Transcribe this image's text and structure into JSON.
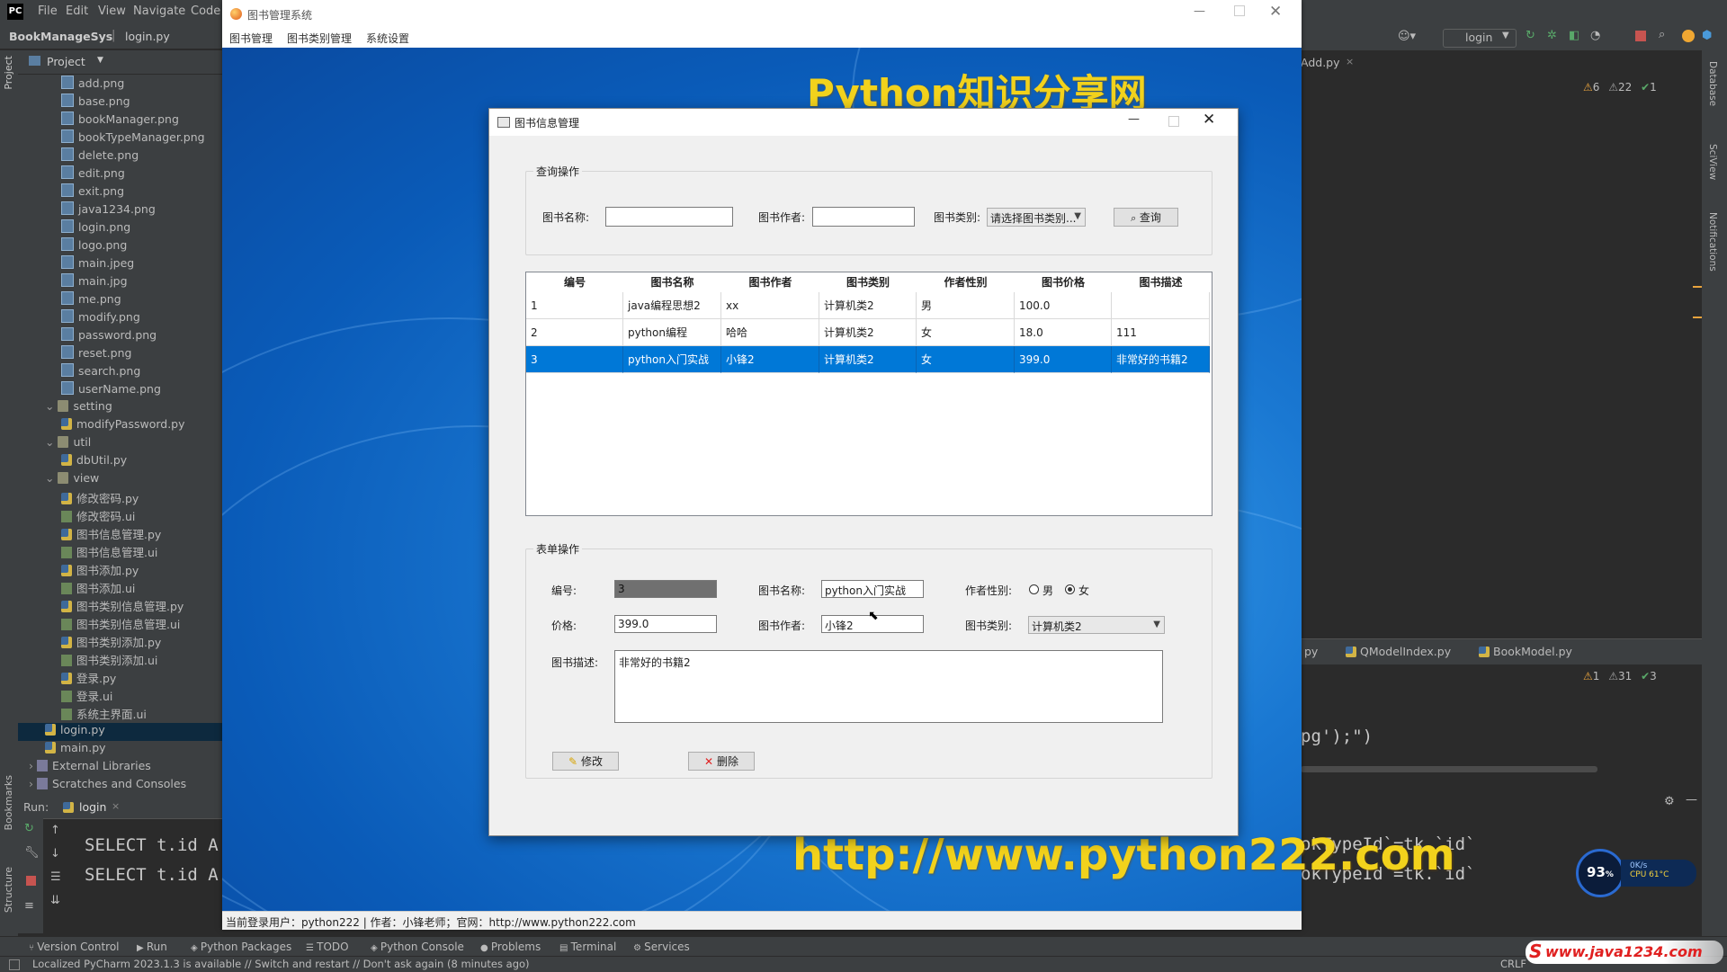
{
  "ide": {
    "logo": "PC",
    "menus": [
      "File",
      "Edit",
      "View",
      "Navigate",
      "Code"
    ],
    "project_name": "BookManageSys",
    "current_file": "login.py",
    "project_label": "Project",
    "left_strip": [
      "Project",
      "Bookmarks",
      "Structure"
    ],
    "right_strip": [
      "Database",
      "SciView",
      "Notifications"
    ],
    "run_config": "login",
    "tree": [
      {
        "name": "add.png",
        "type": "img",
        "level": 3
      },
      {
        "name": "base.png",
        "type": "img",
        "level": 3
      },
      {
        "name": "bookManager.png",
        "type": "img",
        "level": 3
      },
      {
        "name": "bookTypeManager.png",
        "type": "img",
        "level": 3
      },
      {
        "name": "delete.png",
        "type": "img",
        "level": 3
      },
      {
        "name": "edit.png",
        "type": "img",
        "level": 3
      },
      {
        "name": "exit.png",
        "type": "img",
        "level": 3
      },
      {
        "name": "java1234.png",
        "type": "img",
        "level": 3
      },
      {
        "name": "login.png",
        "type": "img",
        "level": 3
      },
      {
        "name": "logo.png",
        "type": "img",
        "level": 3
      },
      {
        "name": "main.jpeg",
        "type": "img",
        "level": 3
      },
      {
        "name": "main.jpg",
        "type": "img",
        "level": 3
      },
      {
        "name": "me.png",
        "type": "img",
        "level": 3
      },
      {
        "name": "modify.png",
        "type": "img",
        "level": 3
      },
      {
        "name": "password.png",
        "type": "img",
        "level": 3
      },
      {
        "name": "reset.png",
        "type": "img",
        "level": 3
      },
      {
        "name": "search.png",
        "type": "img",
        "level": 3
      },
      {
        "name": "userName.png",
        "type": "img",
        "level": 3
      },
      {
        "name": "setting",
        "type": "folder",
        "level": 2
      },
      {
        "name": "modifyPassword.py",
        "type": "py",
        "level": 3
      },
      {
        "name": "util",
        "type": "folder",
        "level": 2
      },
      {
        "name": "dbUtil.py",
        "type": "py",
        "level": 3
      },
      {
        "name": "view",
        "type": "folder",
        "level": 2
      },
      {
        "name": "修改密码.py",
        "type": "py",
        "level": 3
      },
      {
        "name": "修改密码.ui",
        "type": "ui",
        "level": 3
      },
      {
        "name": "图书信息管理.py",
        "type": "py",
        "level": 3
      },
      {
        "name": "图书信息管理.ui",
        "type": "ui",
        "level": 3
      },
      {
        "name": "图书添加.py",
        "type": "py",
        "level": 3
      },
      {
        "name": "图书添加.ui",
        "type": "ui",
        "level": 3
      },
      {
        "name": "图书类别信息管理.py",
        "type": "py",
        "level": 3
      },
      {
        "name": "图书类别信息管理.ui",
        "type": "ui",
        "level": 3
      },
      {
        "name": "图书类别添加.py",
        "type": "py",
        "level": 3
      },
      {
        "name": "图书类别添加.ui",
        "type": "ui",
        "level": 3
      },
      {
        "name": "登录.py",
        "type": "py",
        "level": 3
      },
      {
        "name": "登录.ui",
        "type": "ui",
        "level": 3
      },
      {
        "name": "系统主界面.ui",
        "type": "ui",
        "level": 3
      },
      {
        "name": "login.py",
        "type": "py",
        "level": 2,
        "selected": true
      },
      {
        "name": "main.py",
        "type": "py",
        "level": 2
      },
      {
        "name": "External Libraries",
        "type": "lib",
        "level": 1
      },
      {
        "name": "Scratches and Consoles",
        "type": "lib",
        "level": 1
      }
    ],
    "run": {
      "label": "Run:",
      "tab": "login",
      "lines": [
        "SELECT t.id A",
        "SELECT t.id A"
      ]
    },
    "editor_right": {
      "top_tab": "Add.py",
      "inspect_top": {
        "warnings": "6",
        "weak": "22",
        "ok": "1"
      },
      "bottom_tabs": [
        "py",
        "QModelIndex.py",
        "BookModel.py"
      ],
      "inspect_bottom": {
        "warnings": "1",
        "weak": "31",
        "ok": "3"
      },
      "code_line": "pg');\")",
      "console_lines": [
        "okTypeId`=tk.`id`",
        "okTypeId`=tk.`id`"
      ]
    },
    "bottom_tabs": [
      "Version Control",
      "Run",
      "Python Packages",
      "TODO",
      "Python Console",
      "Problems",
      "Terminal",
      "Services"
    ],
    "status_message": "Localized PyCharm 2023.1.3 is available // Switch and restart // Don't ask again (8 minutes ago)",
    "status_right": "CRLF",
    "cpu_widget": {
      "percent": "93",
      "unit": "%",
      "net": "0K/s",
      "cpu": "CPU 61°C"
    },
    "corner_watermark": "www.java1234.com"
  },
  "app": {
    "title": "图书管理系统",
    "menus": [
      "图书管理",
      "图书类别管理",
      "系统设置"
    ],
    "watermark_top": "Python知识分享网",
    "watermark_bottom": "http://www.python222.com",
    "status": "当前登录用户：python222 | 作者：小锋老师；官网：http://www.python222.com"
  },
  "dialog": {
    "title": "图书信息管理",
    "query_group": "查询操作",
    "query": {
      "name_label": "图书名称:",
      "name_value": "",
      "author_label": "图书作者:",
      "author_value": "",
      "type_label": "图书类别:",
      "type_value": "请选择图书类别...",
      "search_button": "查询"
    },
    "table": {
      "headers": [
        "编号",
        "图书名称",
        "图书作者",
        "图书类别",
        "作者性别",
        "图书价格",
        "图书描述"
      ],
      "rows": [
        [
          "1",
          "java编程思想2",
          "xx",
          "计算机类2",
          "男",
          "100.0",
          ""
        ],
        [
          "2",
          "python编程",
          "哈哈",
          "计算机类2",
          "女",
          "18.0",
          "111"
        ],
        [
          "3",
          "python入门实战",
          "小锋2",
          "计算机类2",
          "女",
          "399.0",
          "非常好的书籍2"
        ]
      ],
      "selected_row": 2
    },
    "form_group": "表单操作",
    "form": {
      "id_label": "编号:",
      "id_value": "3",
      "name_label": "图书名称:",
      "name_value": "python入门实战",
      "gender_label": "作者性别:",
      "gender_male": "男",
      "gender_female": "女",
      "gender_selected": "女",
      "price_label": "价格:",
      "price_value": "399.0",
      "author_label": "图书作者:",
      "author_value": "小锋2",
      "type_label": "图书类别:",
      "type_value": "计算机类2",
      "desc_label": "图书描述:",
      "desc_value": "非常好的书籍2",
      "modify_button": "修改",
      "delete_button": "删除"
    }
  }
}
